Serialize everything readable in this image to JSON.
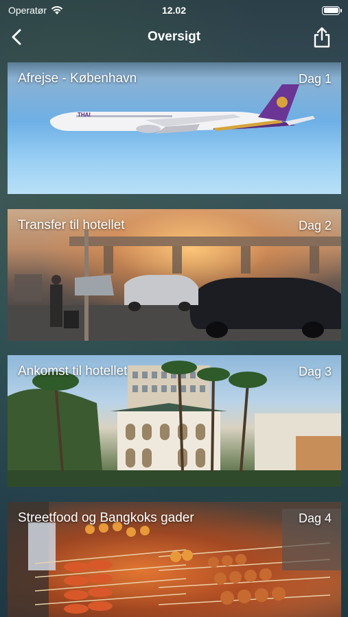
{
  "status_bar": {
    "carrier": "Operatør",
    "time": "12.02"
  },
  "nav": {
    "title": "Oversigt",
    "back_icon": "chevron-left-icon",
    "share_icon": "share-icon"
  },
  "days": [
    {
      "title": "Afrejse - København",
      "day": "Dag 1",
      "image": "airplane-in-sky"
    },
    {
      "title": "Transfer til hotellet",
      "day": "Dag 2",
      "image": "airport-taxi-street"
    },
    {
      "title": "Ankomst til hotellet",
      "day": "Dag 3",
      "image": "colonial-hotel-with-palms"
    },
    {
      "title": "Streetfood og Bangkoks gader",
      "day": "Dag 4",
      "image": "grilled-skewers-food-stall"
    }
  ],
  "colors": {
    "background": "#2b3f48",
    "text": "#ffffff",
    "airline_purple": "#5a2d82",
    "airline_gold": "#d6a43a"
  }
}
